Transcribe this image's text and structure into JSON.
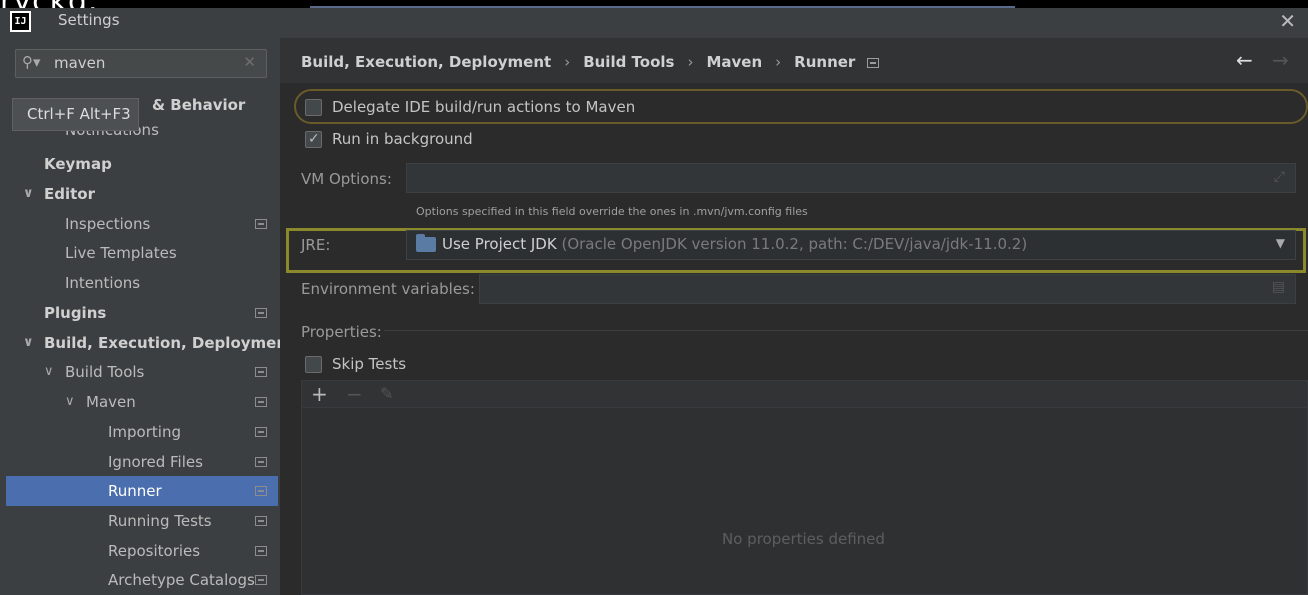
{
  "overlay_text": "ryckd.",
  "window": {
    "title": "Settings",
    "app_icon_text": "IJ",
    "close_icon": "close-icon"
  },
  "sidebar": {
    "search": {
      "value": "maven",
      "placeholder": ""
    },
    "tooltip": "Ctrl+F Alt+F3",
    "items": [
      {
        "label": "Appearance & Behavior",
        "bold": true,
        "partial_label": "& Behavior"
      },
      {
        "label": "Notifications"
      },
      {
        "label": "Keymap",
        "bold": true
      },
      {
        "label": "Editor",
        "bold": true
      },
      {
        "label": "Inspections"
      },
      {
        "label": "Live Templates"
      },
      {
        "label": "Intentions"
      },
      {
        "label": "Plugins",
        "bold": true
      },
      {
        "label": "Build, Execution, Deployment",
        "bold": true
      },
      {
        "label": "Build Tools"
      },
      {
        "label": "Maven"
      },
      {
        "label": "Importing"
      },
      {
        "label": "Ignored Files"
      },
      {
        "label": "Runner",
        "selected": true
      },
      {
        "label": "Running Tests"
      },
      {
        "label": "Repositories"
      },
      {
        "label": "Archetype Catalogs"
      }
    ]
  },
  "breadcrumb": [
    "Build, Execution, Deployment",
    "Build Tools",
    "Maven",
    "Runner"
  ],
  "form": {
    "delegate_label": "Delegate IDE build/run actions to Maven",
    "delegate_checked": false,
    "run_bg_label": "Run in background",
    "run_bg_checked": true,
    "vm_options_label": "VM Options:",
    "vm_options_value": "",
    "vm_hint": "Options specified in this field override the ones in .mvn/jvm.config files",
    "jre_label": "JRE:",
    "jre_value": "Use Project JDK",
    "jre_detail": "(Oracle OpenJDK version 11.0.2, path: C:/DEV/java/jdk-11.0.2)",
    "env_label": "Environment variables:",
    "env_value": "",
    "properties_label": "Properties:",
    "skip_tests_label": "Skip Tests",
    "skip_tests_checked": false,
    "empty_props": "No properties defined"
  },
  "colors": {
    "selection": "#4b6eaf",
    "jre_highlight": "#8a8a2c",
    "delegate_highlight": "#6a5b2a"
  }
}
